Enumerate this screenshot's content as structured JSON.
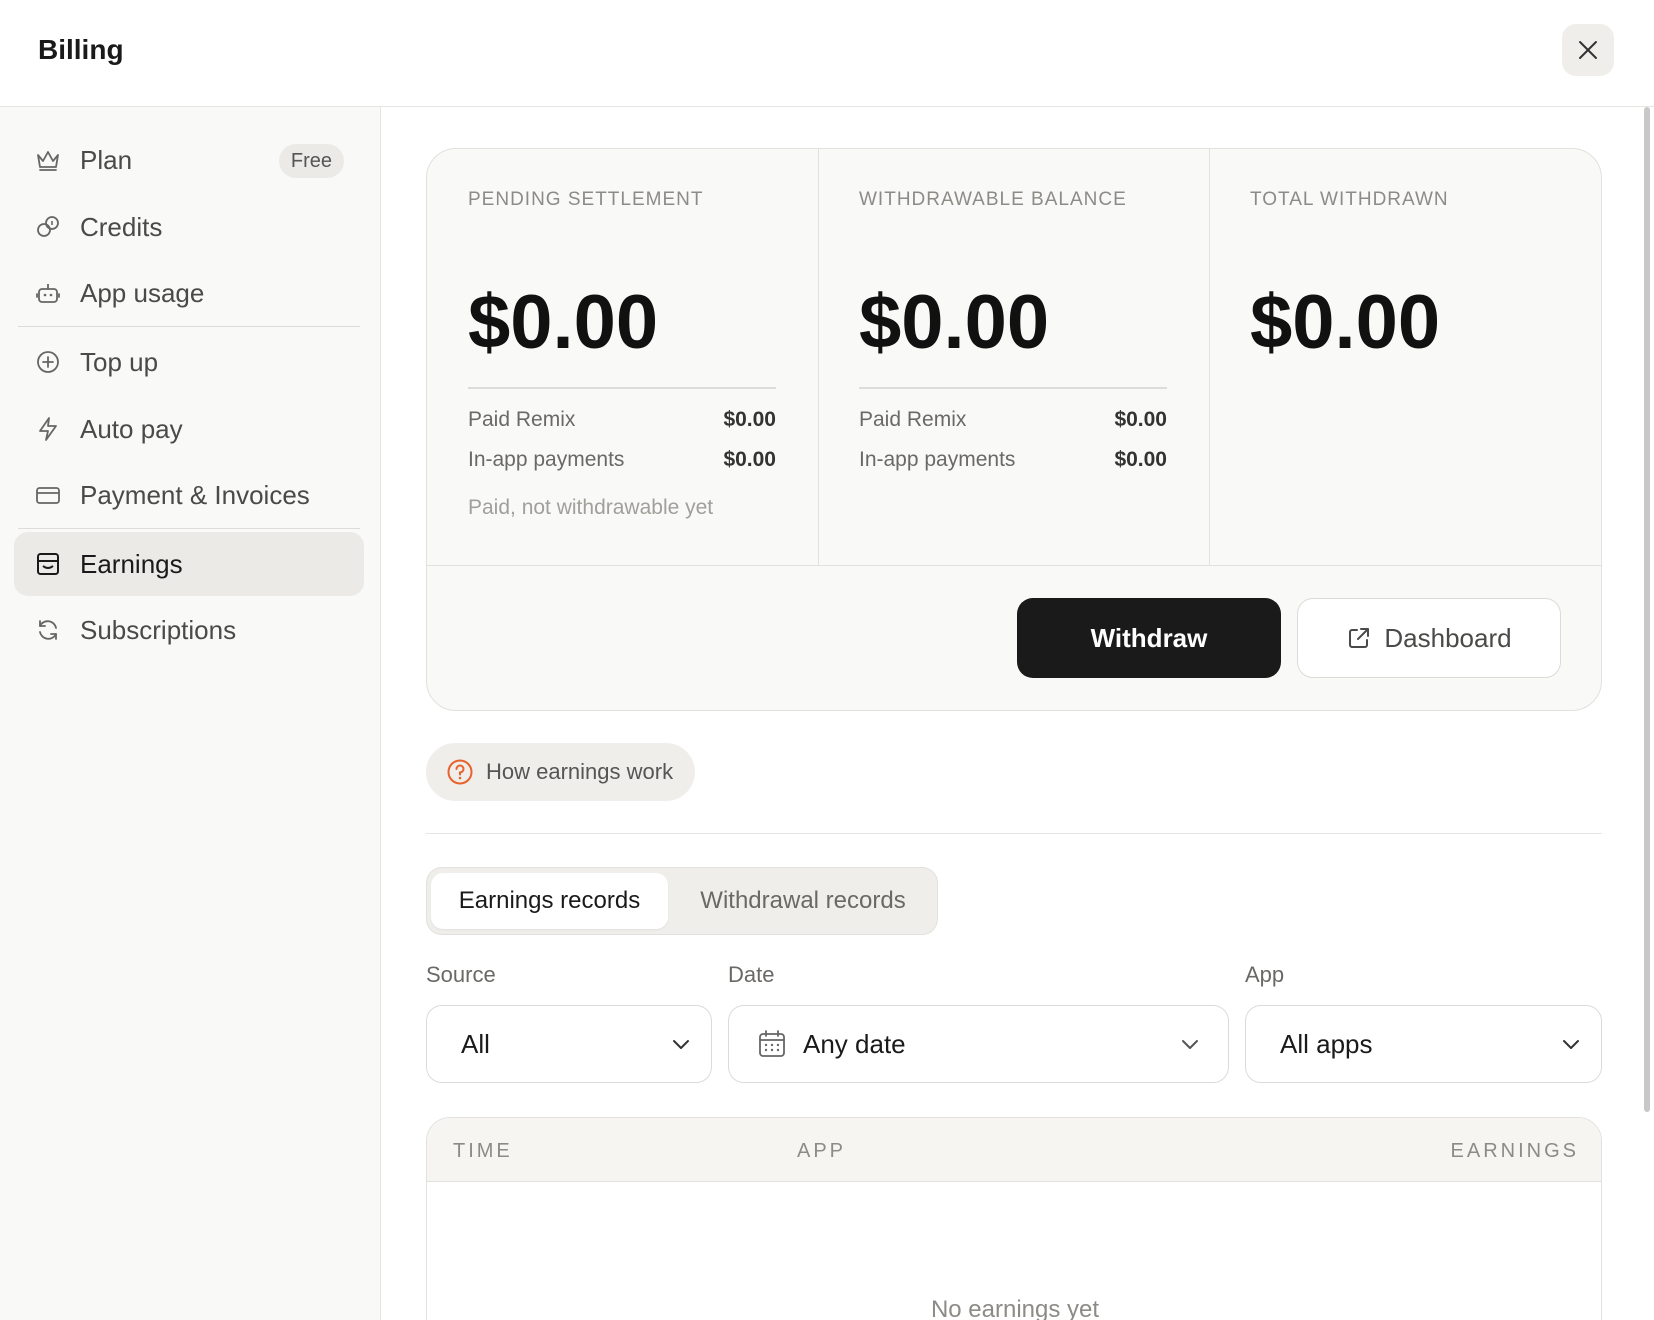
{
  "header": {
    "title": "Billing",
    "close_icon": "close-icon"
  },
  "sidebar": {
    "items": [
      {
        "label": "Plan",
        "icon": "crown-icon",
        "badge": "Free"
      },
      {
        "label": "Credits",
        "icon": "coins-icon"
      },
      {
        "label": "App usage",
        "icon": "robot-icon"
      },
      {
        "label": "Top up",
        "icon": "plus-circle-icon"
      },
      {
        "label": "Auto pay",
        "icon": "lightning-icon"
      },
      {
        "label": "Payment & Invoices",
        "icon": "credit-card-icon"
      },
      {
        "label": "Earnings",
        "icon": "wallet-icon",
        "active": true
      },
      {
        "label": "Subscriptions",
        "icon": "refresh-icon"
      }
    ]
  },
  "summary": {
    "pending": {
      "label": "PENDING SETTLEMENT",
      "amount": "$0.00",
      "rows": [
        {
          "label": "Paid Remix",
          "value": "$0.00"
        },
        {
          "label": "In-app payments",
          "value": "$0.00"
        }
      ],
      "note": "Paid, not withdrawable yet"
    },
    "withdrawable": {
      "label": "WITHDRAWABLE BALANCE",
      "amount": "$0.00",
      "rows": [
        {
          "label": "Paid Remix",
          "value": "$0.00"
        },
        {
          "label": "In-app payments",
          "value": "$0.00"
        }
      ]
    },
    "total": {
      "label": "TOTAL WITHDRAWN",
      "amount": "$0.00"
    },
    "withdraw_label": "Withdraw",
    "dashboard_label": "Dashboard"
  },
  "help": {
    "label": "How earnings work"
  },
  "tabs": [
    {
      "label": "Earnings records",
      "active": true
    },
    {
      "label": "Withdrawal records",
      "active": false
    }
  ],
  "filters": {
    "source": {
      "label": "Source",
      "value": "All"
    },
    "date": {
      "label": "Date",
      "value": "Any date"
    },
    "app": {
      "label": "App",
      "value": "All apps"
    }
  },
  "table": {
    "columns": [
      "TIME",
      "APP",
      "EARNINGS"
    ],
    "empty_text": "No earnings yet"
  },
  "colors": {
    "accent": "#e8622c",
    "primary_button": "#1a1a1a",
    "active_nav": "#ebeae6"
  }
}
